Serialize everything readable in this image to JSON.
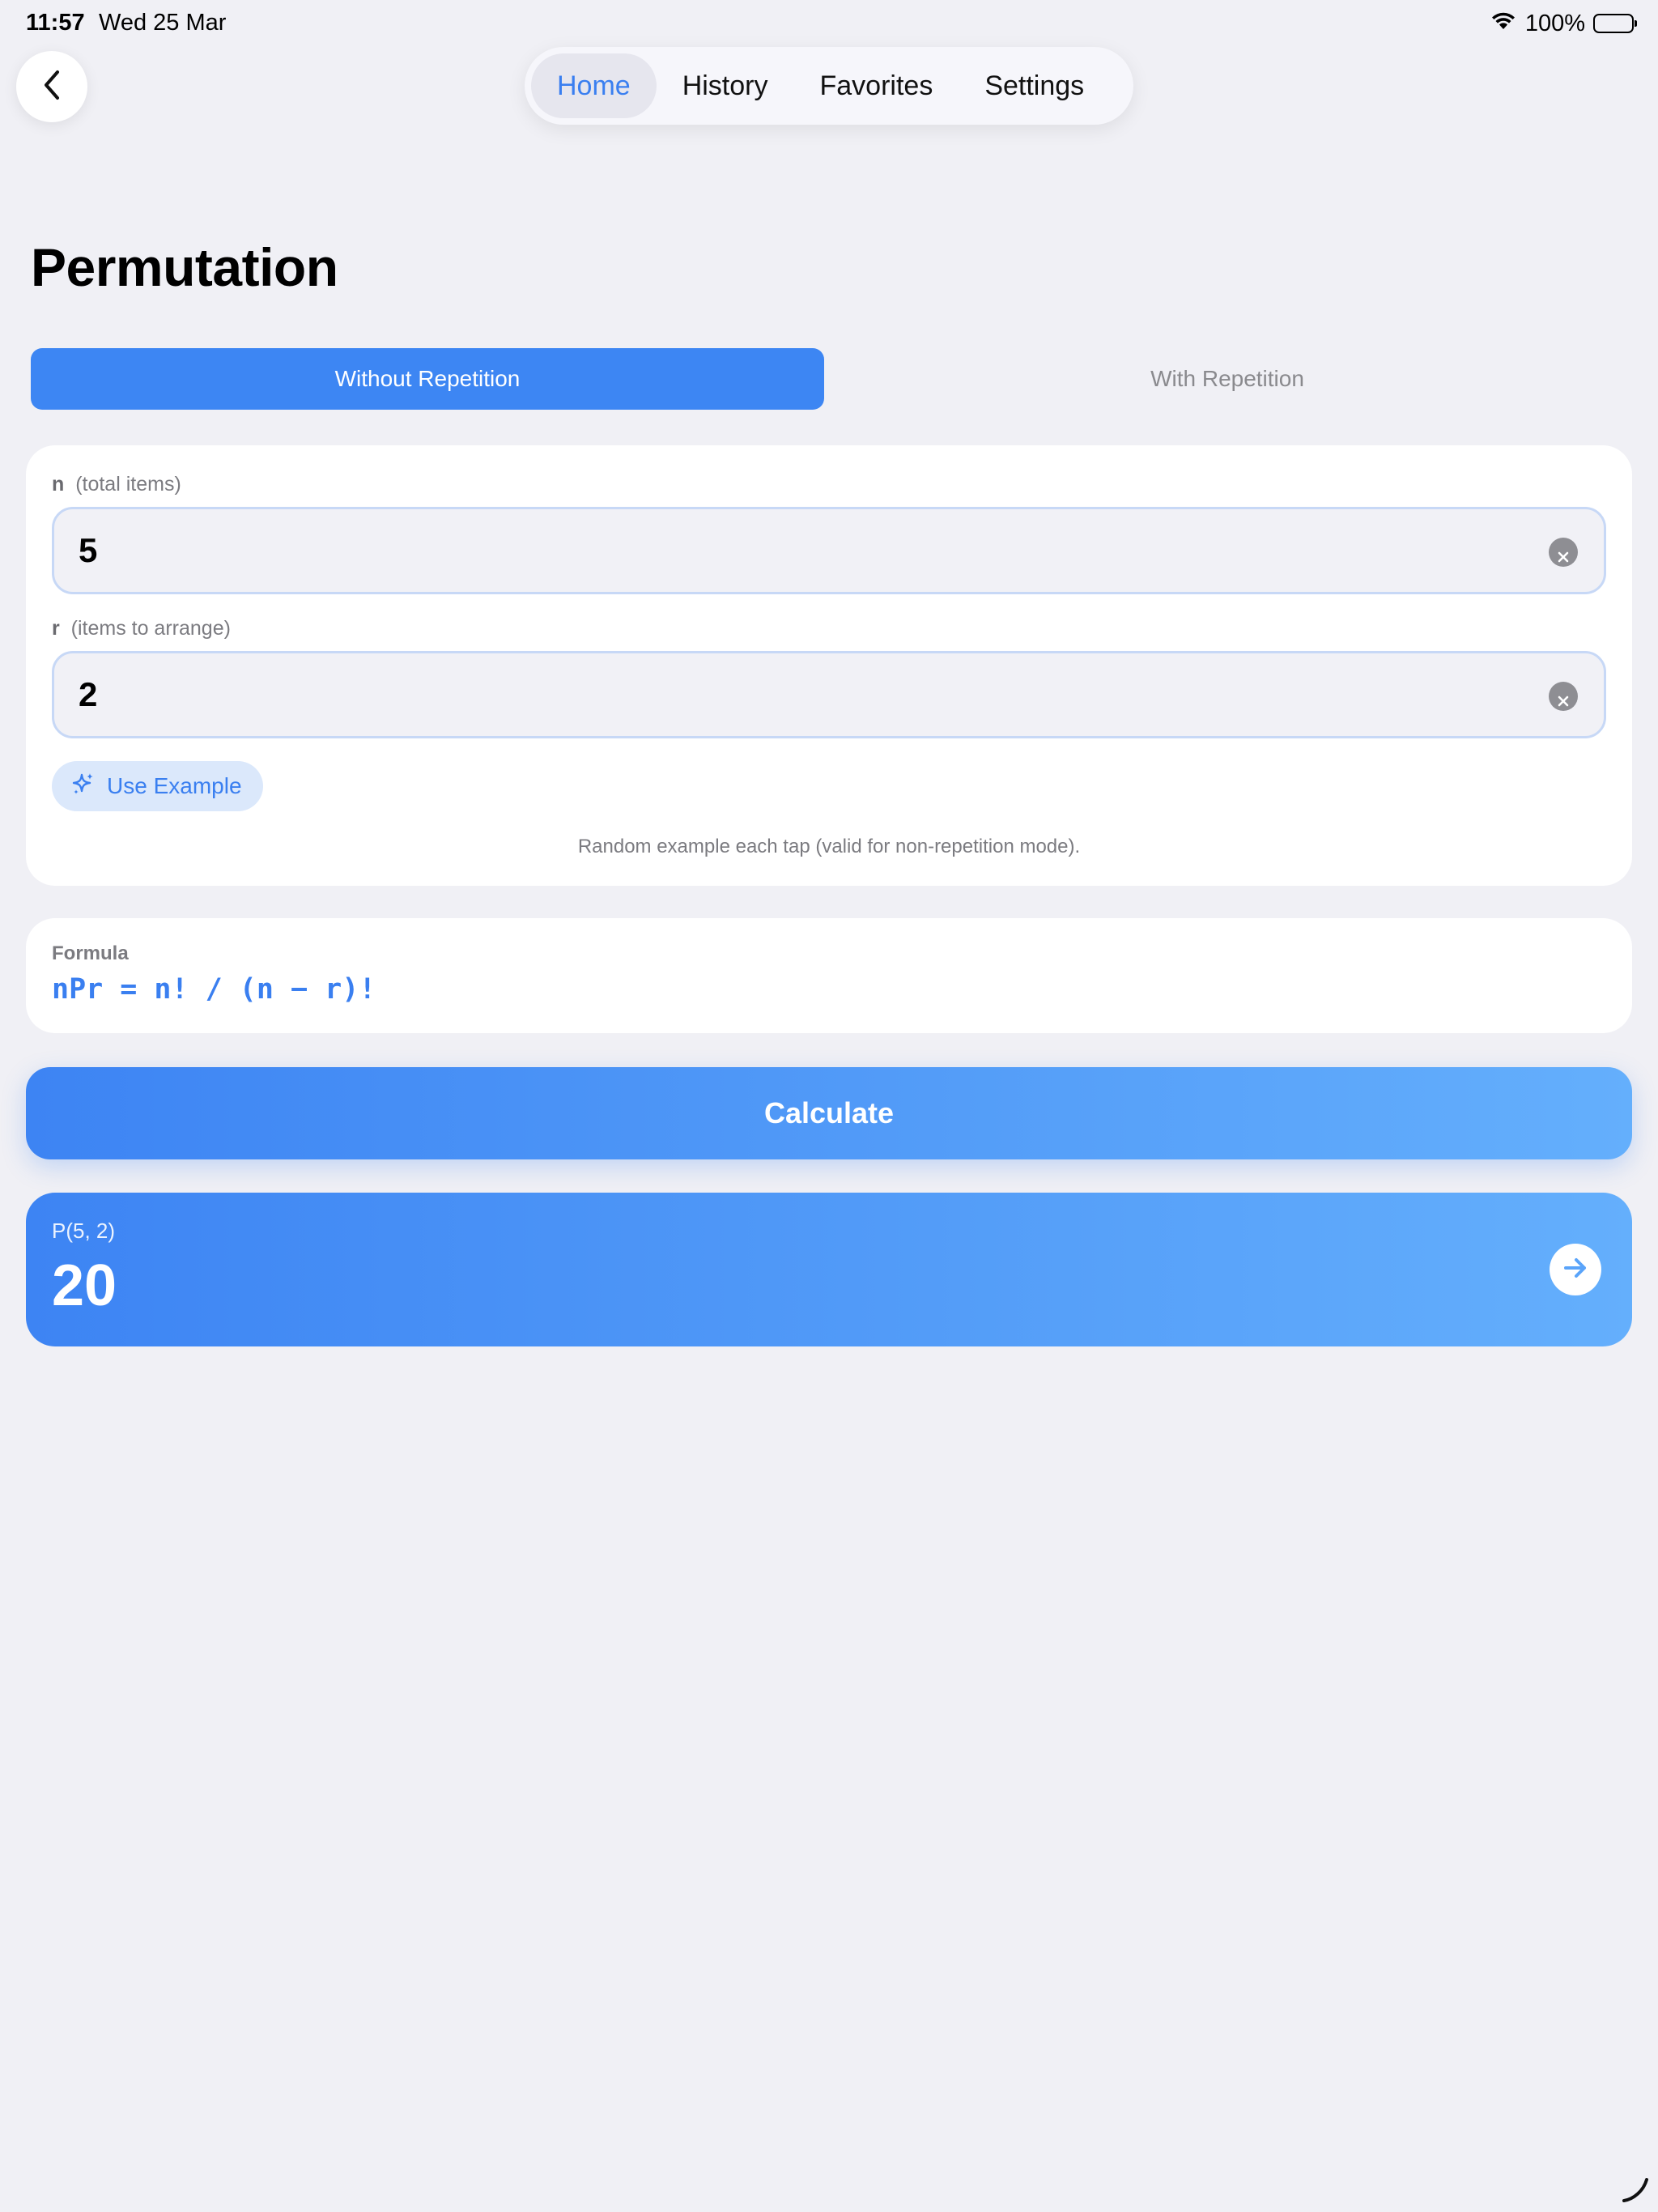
{
  "status_bar": {
    "time": "11:57",
    "date": "Wed 25 Mar",
    "battery": "100%"
  },
  "nav": {
    "tabs": [
      {
        "label": "Home",
        "active": true
      },
      {
        "label": "History",
        "active": false
      },
      {
        "label": "Favorites",
        "active": false
      },
      {
        "label": "Settings",
        "active": false
      }
    ]
  },
  "page": {
    "title": "Permutation"
  },
  "mode": {
    "options": [
      "Without Repetition",
      "With Repetition"
    ],
    "selected": "Without Repetition"
  },
  "inputs": {
    "n": {
      "var": "n",
      "label": "(total items)",
      "value": "5"
    },
    "r": {
      "var": "r",
      "label": "(items to arrange)",
      "value": "2"
    },
    "use_example_label": "Use Example",
    "helper": "Random example each tap (valid for non-repetition mode)."
  },
  "formula": {
    "label": "Formula",
    "text": "nPr = n! / (n − r)!"
  },
  "calculate_label": "Calculate",
  "result": {
    "label": "P(5, 2)",
    "value": "20"
  },
  "colors": {
    "accent": "#3d86f3",
    "accent_light": "#64affc",
    "background": "#f0f0f5"
  }
}
